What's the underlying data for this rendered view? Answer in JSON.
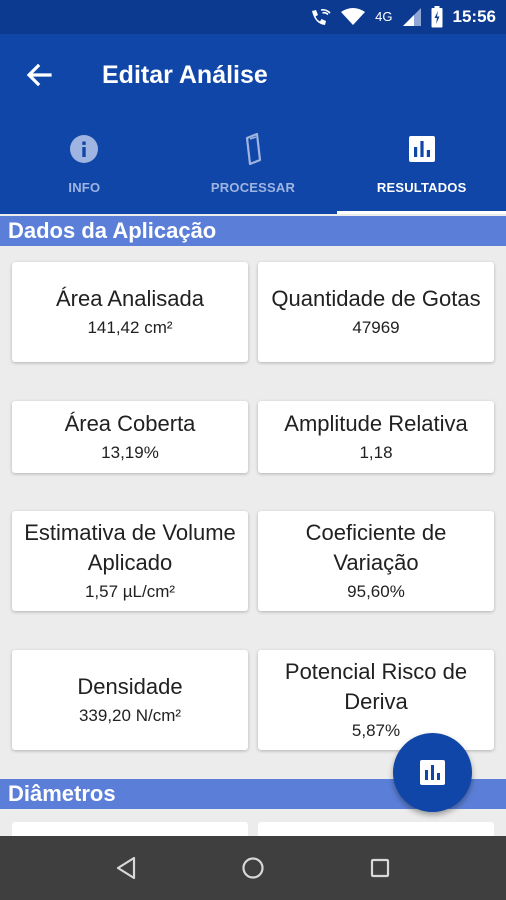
{
  "status_bar": {
    "time": "15:56",
    "network_label": "4G",
    "icons": [
      "wifi-call-icon",
      "wifi-icon",
      "signal-icon",
      "battery-icon"
    ]
  },
  "app_bar": {
    "title": "Editar Análise",
    "back_icon": "arrow-back-icon"
  },
  "tabs": [
    {
      "label": "INFO",
      "icon": "info-icon",
      "active": false
    },
    {
      "label": "PROCESSAR",
      "icon": "card-icon",
      "active": false
    },
    {
      "label": "RESULTADOS",
      "icon": "bar-chart-icon",
      "active": true
    }
  ],
  "sections": {
    "dados": {
      "title": "Dados da Aplicação",
      "cards": [
        {
          "label": "Área Analisada",
          "value": "141,42 cm²"
        },
        {
          "label": "Quantidade de Gotas",
          "value": "47969"
        },
        {
          "label": "Área Coberta",
          "value": "13,19%"
        },
        {
          "label": "Amplitude Relativa",
          "value": "1,18"
        },
        {
          "label": "Estimativa de Volume Aplicado",
          "value": "1,57 µL/cm²"
        },
        {
          "label": "Coeficiente de Variação",
          "value": "95,60%"
        },
        {
          "label": "Densidade",
          "value": "339,20 N/cm²"
        },
        {
          "label": "Potencial Risco de Deriva",
          "value": "5,87%"
        }
      ]
    },
    "diametros": {
      "title": "Diâmetros"
    }
  },
  "colors": {
    "status_bar": "#0d3a91",
    "app_bar": "#0f46a8",
    "section_header": "#5b7fd8",
    "background": "#ececec",
    "nav_bar": "#3f3f3f"
  },
  "fab": {
    "icon": "bar-chart-icon"
  },
  "nav_bar": {
    "icons": [
      "back-triangle-icon",
      "home-circle-icon",
      "recents-square-icon"
    ]
  }
}
